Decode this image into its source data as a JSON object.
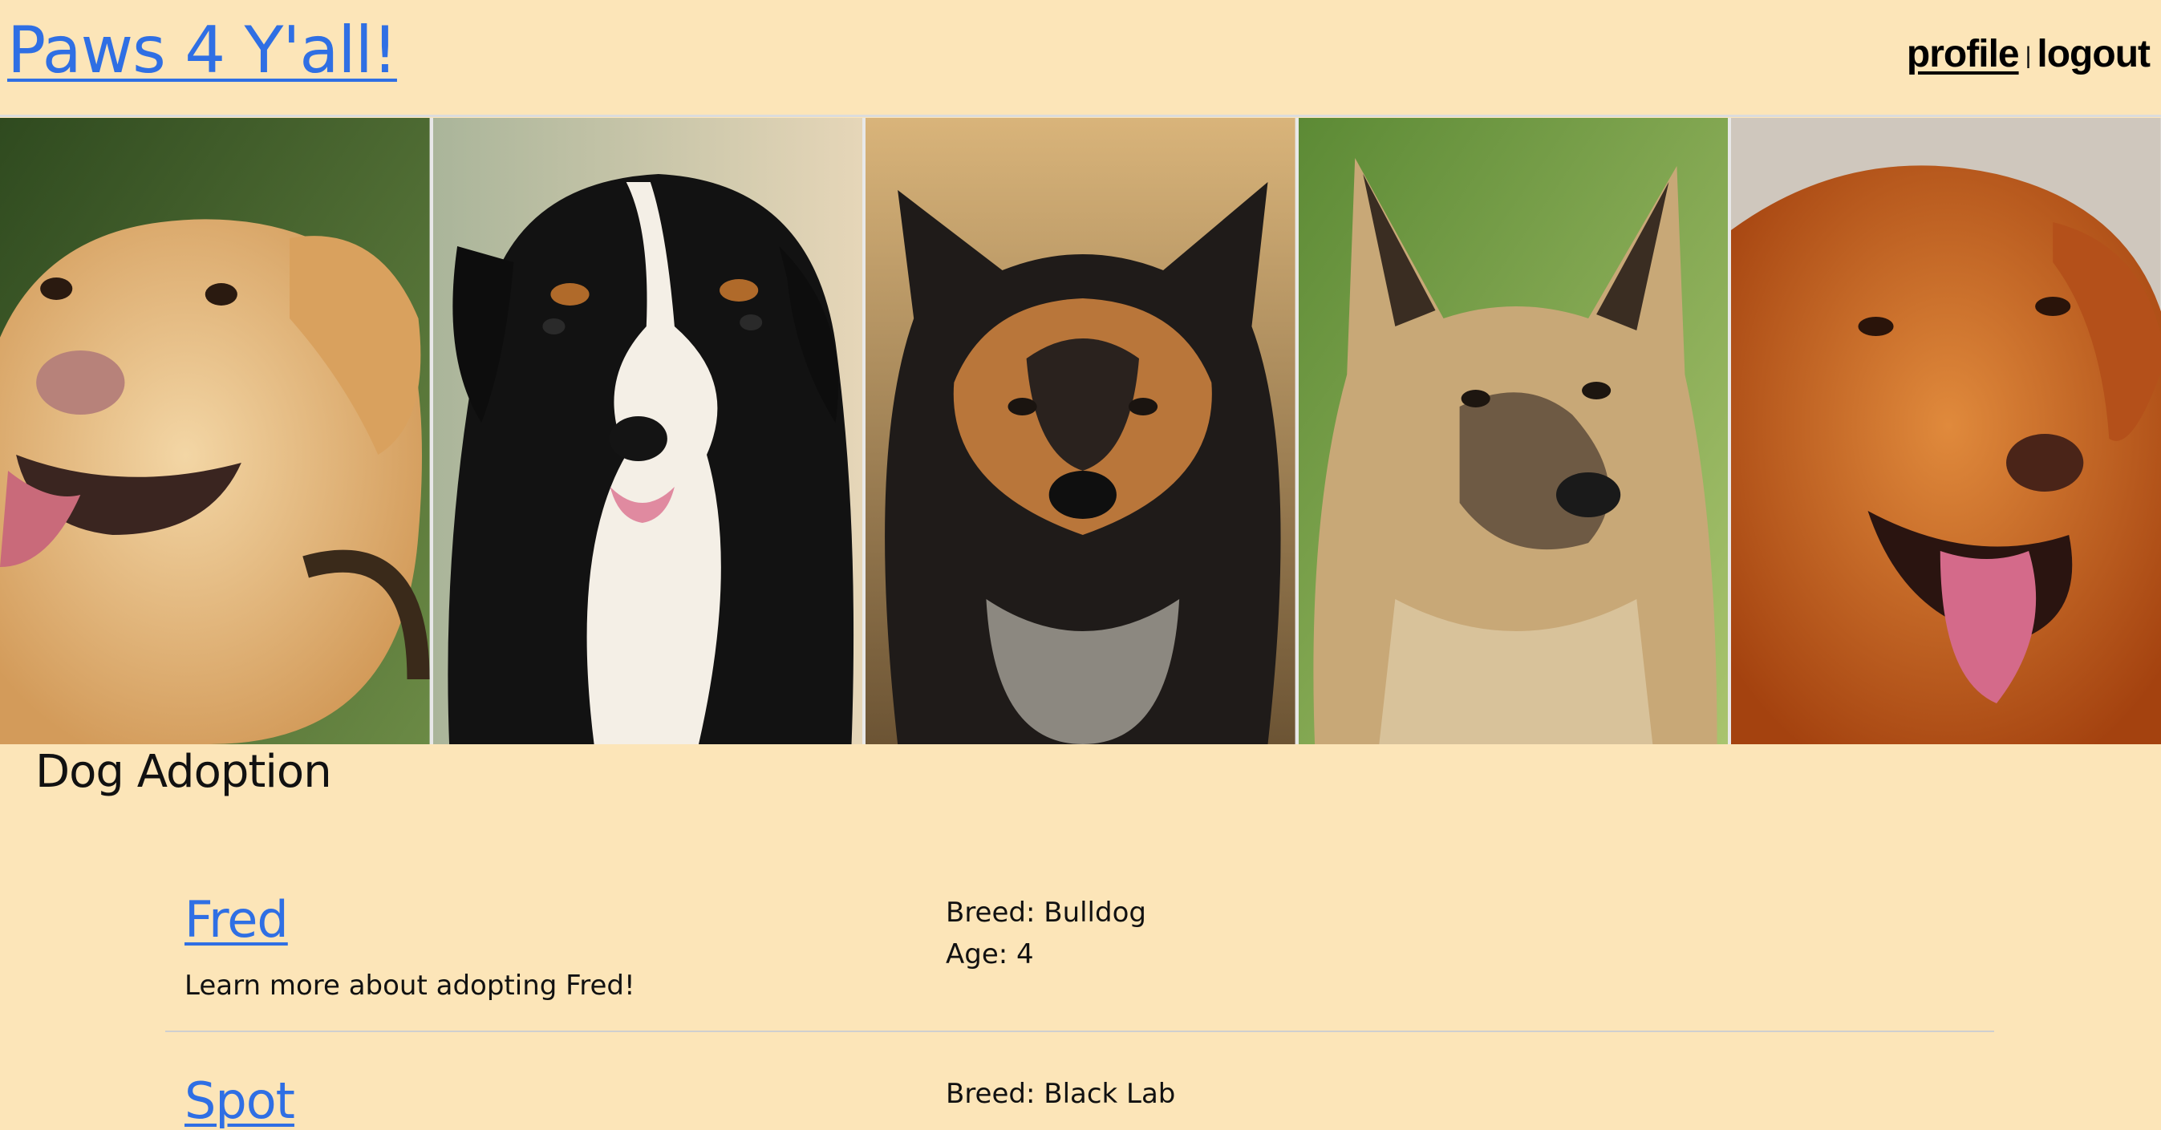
{
  "header": {
    "brand": "Paws 4 Y'all!",
    "nav": {
      "profile": "profile",
      "separator": "|",
      "logout": "logout"
    }
  },
  "gallery": {
    "photos": [
      {
        "icon": "golden-lab-photo",
        "palette": [
          "#3f5a2c",
          "#e8c48e",
          "#d9a663"
        ]
      },
      {
        "icon": "bernese-photo",
        "palette": [
          "#c9cdb4",
          "#121212",
          "#f4efe6"
        ]
      },
      {
        "icon": "collie-photo",
        "palette": [
          "#c9a86a",
          "#1d1a18",
          "#b9763a"
        ]
      },
      {
        "icon": "shepherd-photo",
        "palette": [
          "#7aa64a",
          "#c8a877",
          "#5b4632"
        ]
      },
      {
        "icon": "golden-retriever-photo",
        "palette": [
          "#cfc7bd",
          "#c4581a",
          "#e07a30"
        ]
      }
    ]
  },
  "main": {
    "title": "Dog Adoption",
    "pets": [
      {
        "name": "Fred",
        "description": "Learn more about adopting Fred!",
        "breed": "Breed: Bulldog",
        "age": "Age: 4"
      },
      {
        "name": "Spot",
        "description": "",
        "breed": "Breed: Black Lab",
        "age": ""
      }
    ]
  }
}
